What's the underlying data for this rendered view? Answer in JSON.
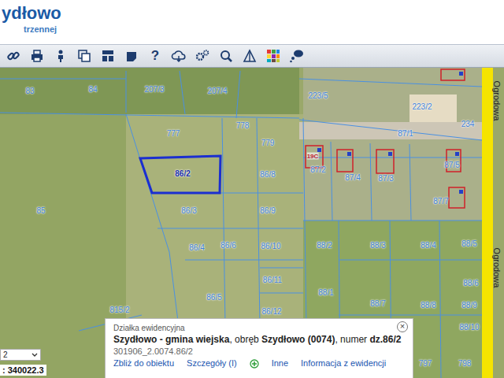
{
  "header": {
    "title": "ydłowo",
    "subtitle": "trzennej"
  },
  "toolbar": {
    "help": "?"
  },
  "map": {
    "parcels": [
      {
        "label": "83",
        "selected": false
      },
      {
        "label": "84",
        "selected": false
      },
      {
        "label": "207/3",
        "selected": false
      },
      {
        "label": "207/4",
        "selected": false
      },
      {
        "label": "223/5",
        "selected": false
      },
      {
        "label": "223/2",
        "selected": false
      },
      {
        "label": "234",
        "selected": false
      },
      {
        "label": "777",
        "selected": false
      },
      {
        "label": "778",
        "selected": false
      },
      {
        "label": "779",
        "selected": false
      },
      {
        "label": "87/1",
        "selected": false
      },
      {
        "label": "86/2",
        "selected": true
      },
      {
        "label": "86/8",
        "selected": false
      },
      {
        "label": "87/2",
        "selected": false
      },
      {
        "label": "87/4",
        "selected": false
      },
      {
        "label": "87/3",
        "selected": false
      },
      {
        "label": "87/5",
        "selected": false
      },
      {
        "label": "87/7",
        "selected": false
      },
      {
        "label": "85",
        "selected": false
      },
      {
        "label": "86/3",
        "selected": false
      },
      {
        "label": "86/9",
        "selected": false
      },
      {
        "label": "86/4",
        "selected": false
      },
      {
        "label": "86/6",
        "selected": false
      },
      {
        "label": "86/10",
        "selected": false
      },
      {
        "label": "88/2",
        "selected": false
      },
      {
        "label": "88/3",
        "selected": false
      },
      {
        "label": "88/4",
        "selected": false
      },
      {
        "label": "88/5",
        "selected": false
      },
      {
        "label": "86/11",
        "selected": false
      },
      {
        "label": "88/6",
        "selected": false
      },
      {
        "label": "86/5",
        "selected": false
      },
      {
        "label": "86/12",
        "selected": false
      },
      {
        "label": "88/1",
        "selected": false
      },
      {
        "label": "88/7",
        "selected": false
      },
      {
        "label": "88/8",
        "selected": false
      },
      {
        "label": "88/9",
        "selected": false
      },
      {
        "label": "815/2",
        "selected": false
      },
      {
        "label": "88/10",
        "selected": false
      },
      {
        "label": "797",
        "selected": false
      },
      {
        "label": "798",
        "selected": false
      }
    ],
    "building_labels": [
      "19C"
    ],
    "streets": [
      "Ogrodowa",
      "Ogrodowa"
    ]
  },
  "scale_select": {
    "value": "2"
  },
  "coordinates": ": 340022.3",
  "popup": {
    "title": "Działka ewidencyjna",
    "close": "×",
    "location": [
      {
        "text": "Szydłowo - gmina wiejska",
        "bold": true
      },
      {
        "text": ", obręb ",
        "bold": false
      },
      {
        "text": "Szydłowo (0074)",
        "bold": true
      },
      {
        "text": ", numer ",
        "bold": false
      },
      {
        "text": "dz.86/2",
        "bold": true
      }
    ],
    "id": "301906_2.0074.86/2",
    "links": [
      "Zbliż do obiektu",
      "Szczegóły (I)",
      "Inne",
      "Informacja z ewidencji"
    ]
  }
}
